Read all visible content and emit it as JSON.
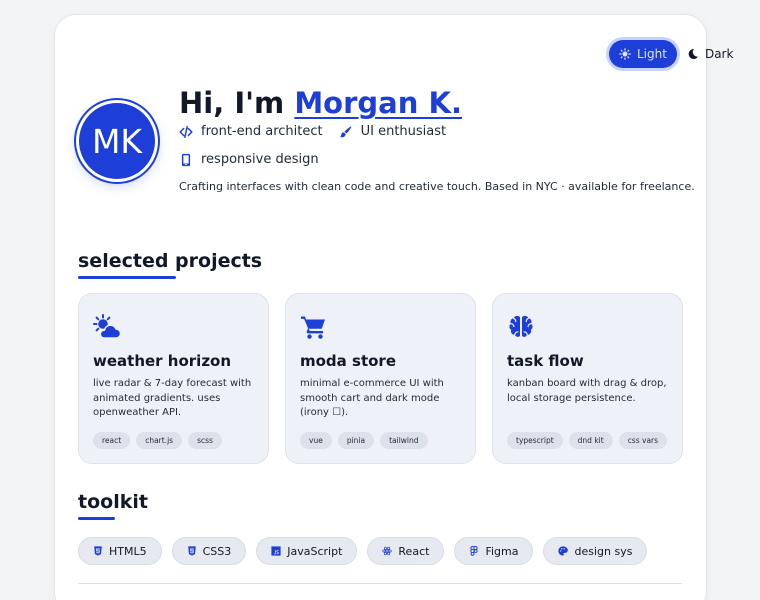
{
  "theme": {
    "light_label": "Light",
    "dark_label": "Dark",
    "active": "light"
  },
  "hero": {
    "avatar_initials": "MK",
    "greeting": "Hi, I'm",
    "name": "Morgan K.",
    "taglines": [
      {
        "icon": "code-icon",
        "text": "front-end architect"
      },
      {
        "icon": "brush-icon",
        "text": "UI enthusiast"
      },
      {
        "icon": "mobile-icon",
        "text": "responsive design"
      }
    ],
    "bio": "Crafting interfaces with clean code and creative touch. Based in NYC · available for freelance."
  },
  "projects": {
    "title": "selected projects",
    "items": [
      {
        "icon": "weather-icon",
        "title": "weather horizon",
        "description": "live radar & 7-day forecast with animated gradients. uses openweather API.",
        "tags": [
          "react",
          "chart.js",
          "scss"
        ]
      },
      {
        "icon": "cart-icon",
        "title": "moda store",
        "description": "minimal e-commerce UI with smooth cart and dark mode (irony ☐).",
        "tags": [
          "vue",
          "pinia",
          "tailwind"
        ]
      },
      {
        "icon": "brain-icon",
        "title": "task flow",
        "description": "kanban board with drag & drop, local storage persistence.",
        "tags": [
          "typescript",
          "dnd kit",
          "css vars"
        ]
      }
    ]
  },
  "toolkit": {
    "title": "toolkit",
    "items": [
      {
        "icon": "html5-icon",
        "label": "HTML5"
      },
      {
        "icon": "css3-icon",
        "label": "CSS3"
      },
      {
        "icon": "javascript-icon",
        "label": "JavaScript"
      },
      {
        "icon": "react-icon",
        "label": "React"
      },
      {
        "icon": "figma-icon",
        "label": "Figma"
      },
      {
        "icon": "palette-icon",
        "label": "design sys"
      }
    ]
  },
  "colors": {
    "accent": "#1d3fd8",
    "card_bg": "#eef1f7",
    "chip_bg": "#e6e9ef",
    "page_bg": "#f3f4f6"
  }
}
